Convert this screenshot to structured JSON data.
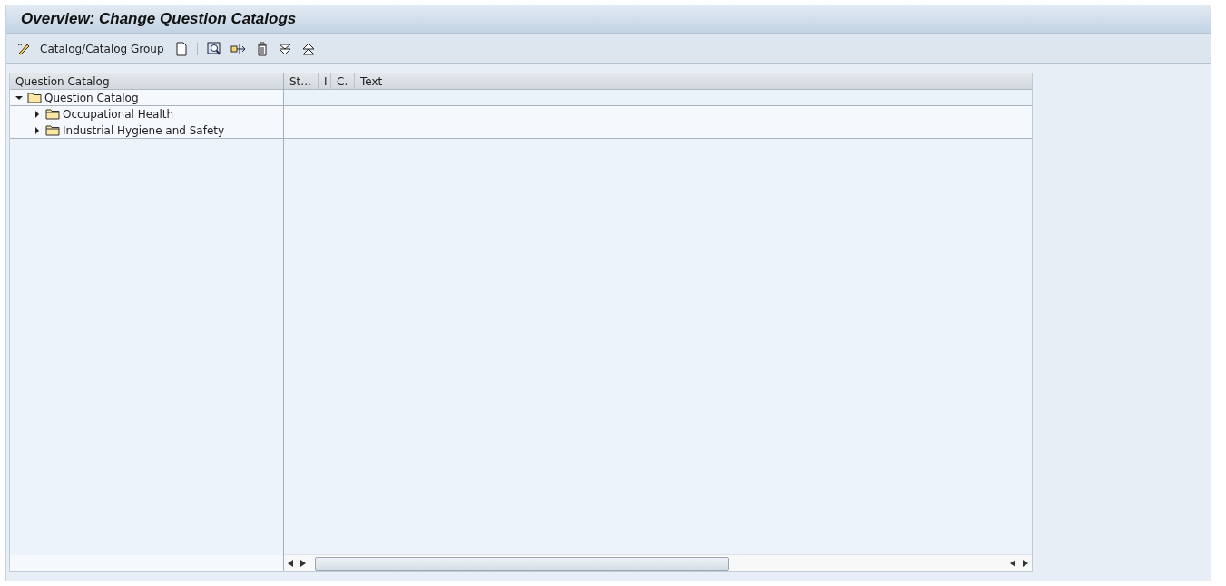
{
  "window": {
    "title": "Overview: Change Question Catalogs"
  },
  "toolbar": {
    "items": [
      {
        "kind": "edit",
        "label": "Catalog/Catalog Group"
      },
      {
        "kind": "new"
      },
      {
        "kind": "separator"
      },
      {
        "kind": "find"
      },
      {
        "kind": "move"
      },
      {
        "kind": "delete"
      },
      {
        "kind": "expand"
      },
      {
        "kind": "collapse"
      }
    ]
  },
  "tree": {
    "header": "Question Catalog",
    "items": [
      {
        "label": "Question Catalog",
        "expanded": true,
        "children": [
          {
            "label": "Occupational Health",
            "expanded": false
          },
          {
            "label": "Industrial Hygiene and Safety",
            "expanded": false
          }
        ]
      }
    ]
  },
  "grid": {
    "columns": [
      "St...",
      "I",
      "C.",
      "Text"
    ]
  }
}
